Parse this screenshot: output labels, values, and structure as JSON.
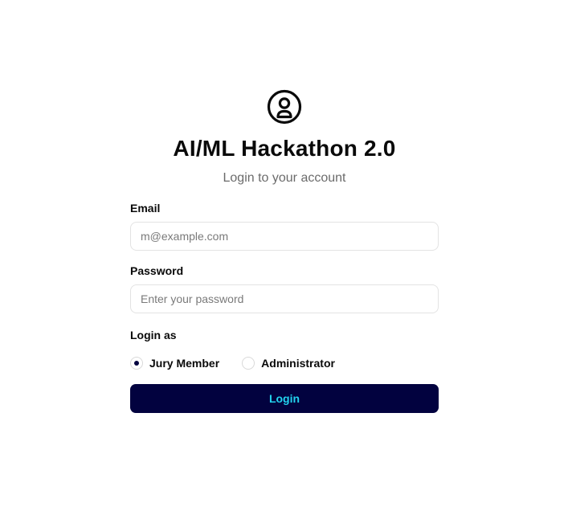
{
  "header": {
    "icon": "user-circle-icon",
    "title": "AI/ML Hackathon 2.0",
    "subtitle": "Login to your account"
  },
  "form": {
    "email": {
      "label": "Email",
      "placeholder": "m@example.com",
      "value": ""
    },
    "password": {
      "label": "Password",
      "placeholder": "Enter your password",
      "value": ""
    },
    "role": {
      "label": "Login as",
      "options": [
        {
          "label": "Jury Member",
          "selected": true
        },
        {
          "label": "Administrator",
          "selected": false
        }
      ]
    },
    "submit_label": "Login"
  },
  "colors": {
    "primary": "#02023f",
    "button_text": "#22d3ee",
    "muted_text": "#6b6b6b",
    "border": "#e3e3e3"
  }
}
